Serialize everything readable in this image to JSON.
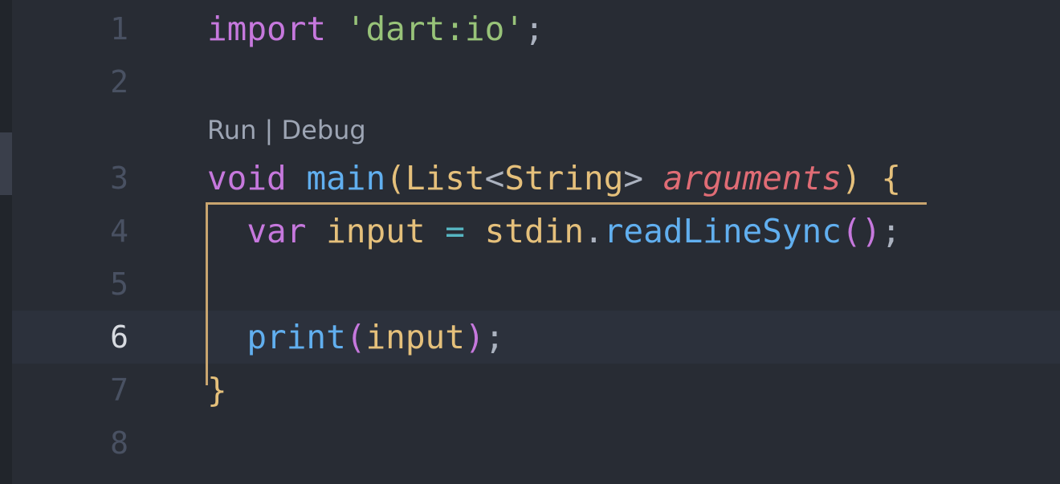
{
  "gutter": {
    "line_numbers": [
      "1",
      "2",
      "3",
      "4",
      "5",
      "6",
      "7",
      "8"
    ],
    "active_line": "6"
  },
  "codelens": {
    "run": "Run",
    "separator": " | ",
    "debug": "Debug"
  },
  "code": {
    "line1": {
      "import_kw": "import",
      "path": "'dart:io'",
      "semi": ";"
    },
    "line3": {
      "void_kw": "void",
      "main_fn": "main",
      "open_paren": "(",
      "list_type": "List",
      "lt": "<",
      "string_type": "String",
      "gt": ">",
      "param": "arguments",
      "close_paren": ")",
      "open_brace": "{"
    },
    "line4": {
      "var_kw": "var",
      "input_var": "input",
      "eq": "=",
      "stdin": "stdin",
      "dot": ".",
      "method": "readLineSync",
      "parens": "()",
      "semi": ";"
    },
    "line6": {
      "print_fn": "print",
      "open_paren": "(",
      "input_var": "input",
      "close_paren": ")",
      "semi": ";"
    },
    "line7": {
      "close_brace": "}"
    }
  },
  "colors": {
    "background": "#282c34",
    "keyword": "#c678dd",
    "string": "#98c379",
    "function": "#61afef",
    "type": "#e5c07b",
    "parameter": "#e06c75",
    "bracket_guide": "#c9a56f"
  }
}
